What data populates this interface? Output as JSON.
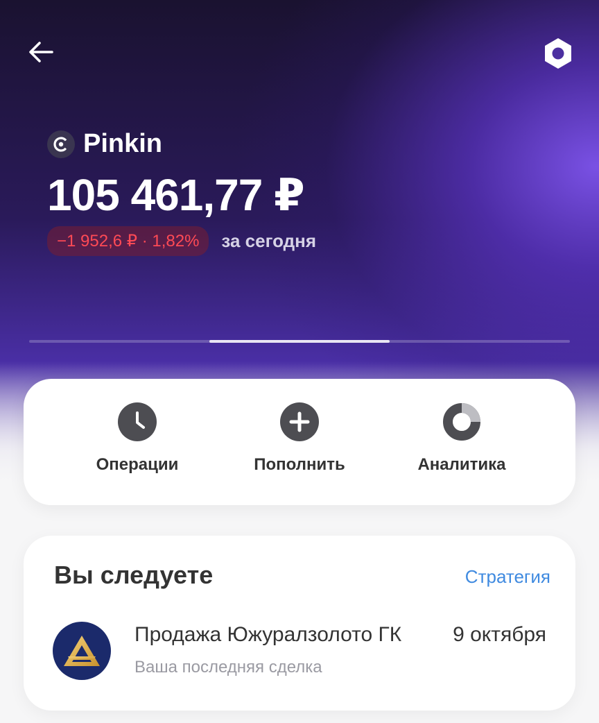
{
  "account": {
    "name": "Pinkin",
    "balance": "105 461,77 ₽",
    "change": "−1 952,6 ₽ · 1,82%",
    "change_period": "за сегодня"
  },
  "actions": [
    {
      "label": "Операции",
      "icon": "clock-icon"
    },
    {
      "label": "Пополнить",
      "icon": "plus-icon"
    },
    {
      "label": "Аналитика",
      "icon": "donut-chart-icon"
    }
  ],
  "following": {
    "title": "Вы следуете",
    "link": "Стратегия",
    "deal": {
      "title": "Продажа Южуралзолото ГК",
      "date": "9 октября",
      "subtitle": "Ваша последняя сделка"
    }
  },
  "colors": {
    "accent_link": "#3f8ae0",
    "negative": "#ff4a55",
    "hero_purple": "#7e54ec"
  }
}
